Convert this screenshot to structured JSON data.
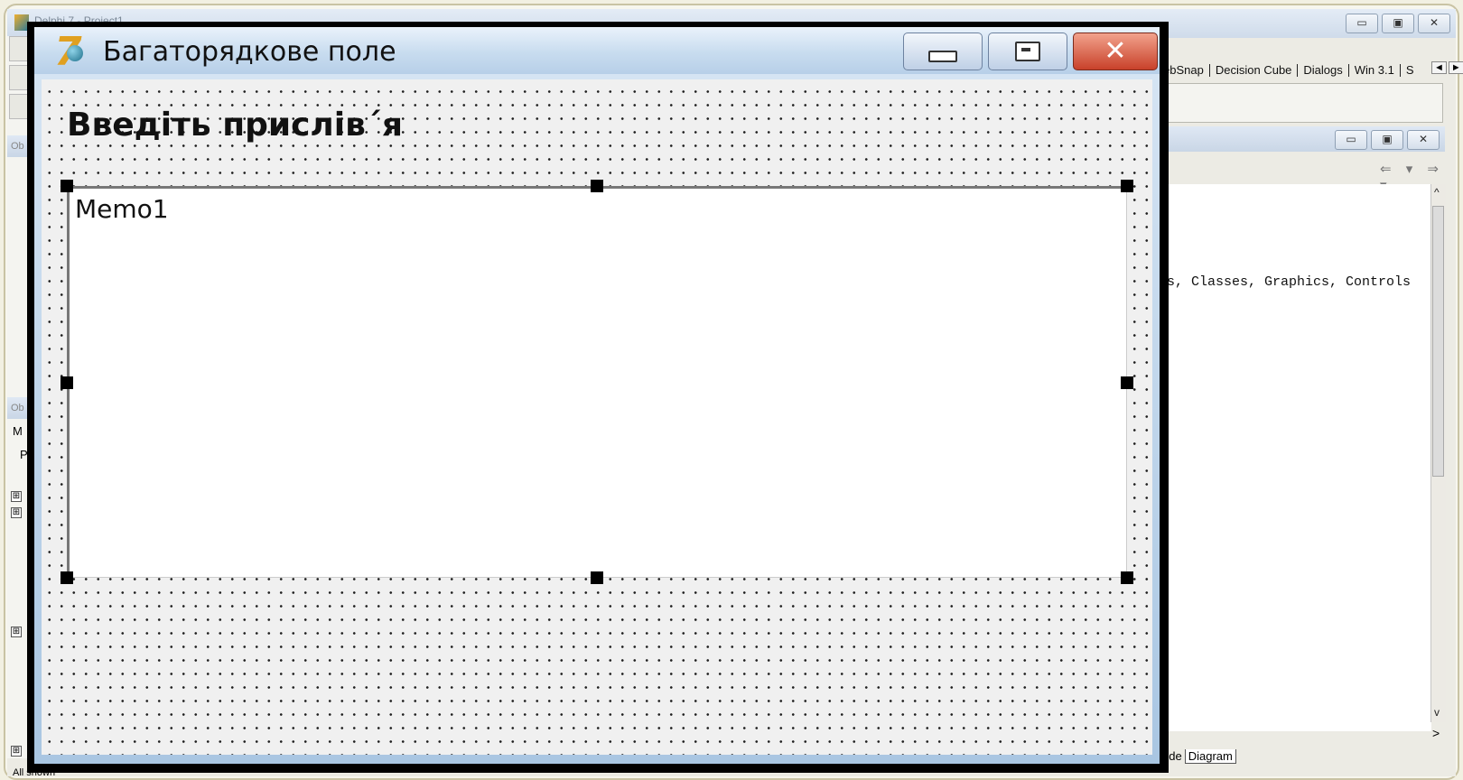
{
  "ide": {
    "title": "Delphi 7 - Project1",
    "palette_tabs": [
      "WebSnap",
      "Decision Cube",
      "Dialogs",
      "Win 3.1",
      "S"
    ],
    "code_line": "ants, Classes, Graphics, Controls",
    "code_tabs": [
      "ode",
      "Diagram"
    ],
    "status_text": "All shown",
    "left_panel_label_1": "Ob",
    "left_panel_label_2": "Ob",
    "left_letter_m": "M",
    "left_letter_p": "P",
    "plus_sign": "⊞",
    "win_minimize": "▭",
    "win_maximize": "▣",
    "win_close": "✕",
    "nav_arrows": "⇐ ▾ ⇒ ▾",
    "scroll_up": "^",
    "scroll_down": "v",
    "scroll_right": ">",
    "pal_left": "◄",
    "pal_right": "►"
  },
  "form": {
    "title": "Багаторядкове поле",
    "label_caption": "Введіть прислів´я",
    "memo_text": "Memo1",
    "close_glyph": "✕"
  },
  "icons": {
    "app": "delphi-7-icon",
    "minimize": "minimize-icon",
    "maximize": "maximize-icon",
    "close": "close-icon"
  },
  "colors": {
    "form_titlebar": "#c8dcef",
    "close_button": "#c8412a",
    "designer_grid_bg": "#f0f0f0"
  }
}
